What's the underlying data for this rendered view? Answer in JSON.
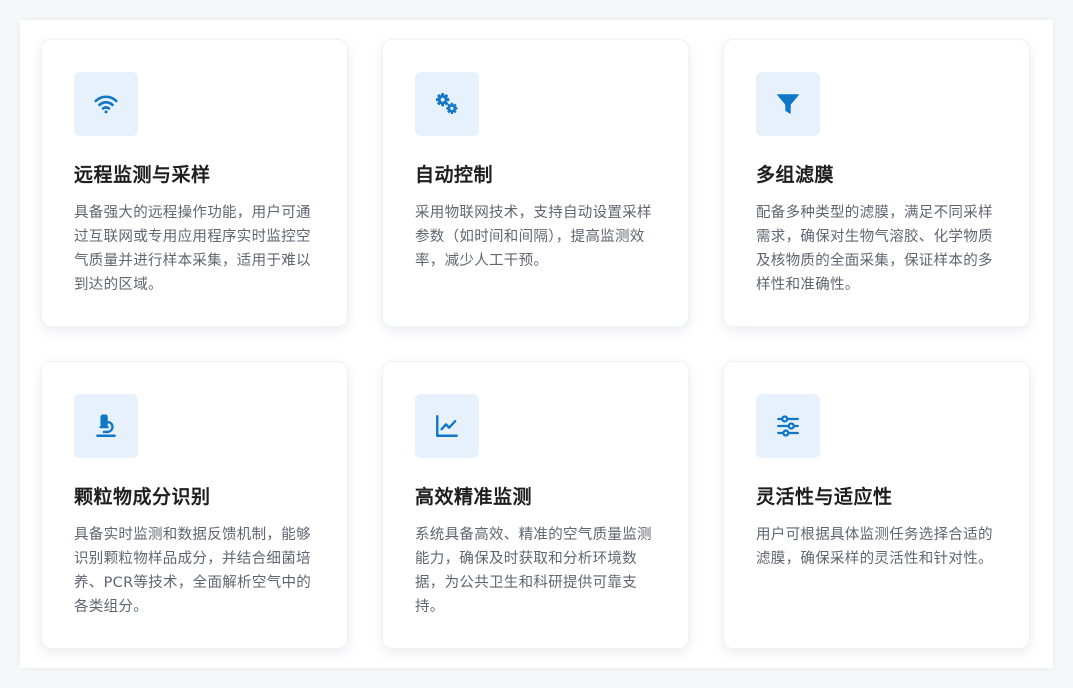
{
  "accent_color": "#0f76c8",
  "icon_bg_color": "#e6f1fc",
  "cards": [
    {
      "icon": "wifi-icon",
      "title": "远程监测与采样",
      "description": "具备强大的远程操作功能，用户可通过互联网或专用应用程序实时监控空气质量并进行样本采集，适用于难以到达的区域。"
    },
    {
      "icon": "gears-icon",
      "title": "自动控制",
      "description": "采用物联网技术，支持自动设置采样参数（如时间和间隔），提高监测效率，减少人工干预。"
    },
    {
      "icon": "filter-icon",
      "title": "多组滤膜",
      "description": "配备多种类型的滤膜，满足不同采样需求，确保对生物气溶胶、化学物质及核物质的全面采集，保证样本的多样性和准确性。"
    },
    {
      "icon": "microscope-icon",
      "title": "颗粒物成分识别",
      "description": "具备实时监测和数据反馈机制，能够识别颗粒物样品成分，并结合细菌培养、PCR等技术，全面解析空气中的各类组分。"
    },
    {
      "icon": "line-chart-icon",
      "title": "高效精准监测",
      "description": "系统具备高效、精准的空气质量监测能力，确保及时获取和分析环境数据，为公共卫生和科研提供可靠支持。"
    },
    {
      "icon": "sliders-icon",
      "title": "灵活性与适应性",
      "description": "用户可根据具体监测任务选择合适的滤膜，确保采样的灵活性和针对性。"
    }
  ]
}
